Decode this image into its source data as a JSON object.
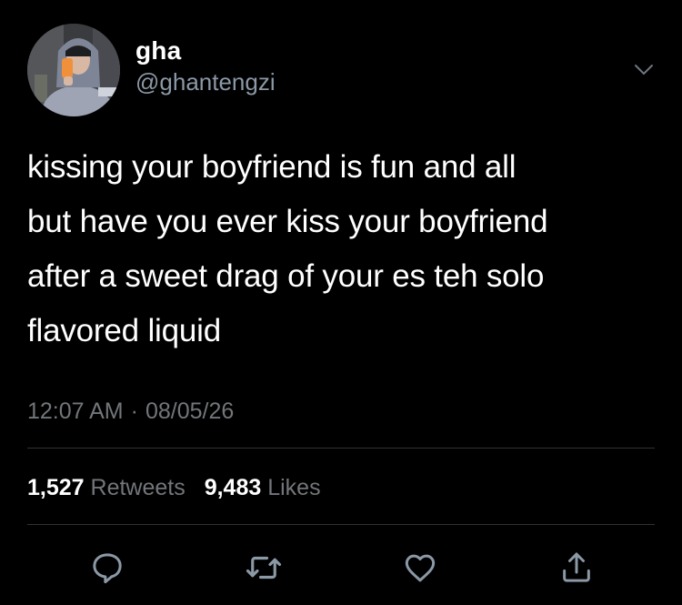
{
  "user": {
    "display_name": "gha",
    "handle": "@ghantengzi",
    "avatar_icon": "profile-photo"
  },
  "tweet": {
    "text": "kissing your boyfriend is fun and all\nbut have you ever kiss your boyfriend\nafter a sweet drag of your es teh solo\nflavored liquid",
    "time": "12:07 AM",
    "separator": "·",
    "date": "08/05/26"
  },
  "stats": {
    "retweets_count": "1,527",
    "retweets_label": "Retweets",
    "likes_count": "9,483",
    "likes_label": "Likes"
  },
  "actions": [
    "reply-icon",
    "retweet-icon",
    "like-icon",
    "share-icon"
  ],
  "colors": {
    "background": "#000000",
    "primary_text": "#ffffff",
    "secondary_text": "#72767a",
    "handle_text": "#8b98a5",
    "divider": "#2f3336",
    "icon": "#8b98a5"
  }
}
